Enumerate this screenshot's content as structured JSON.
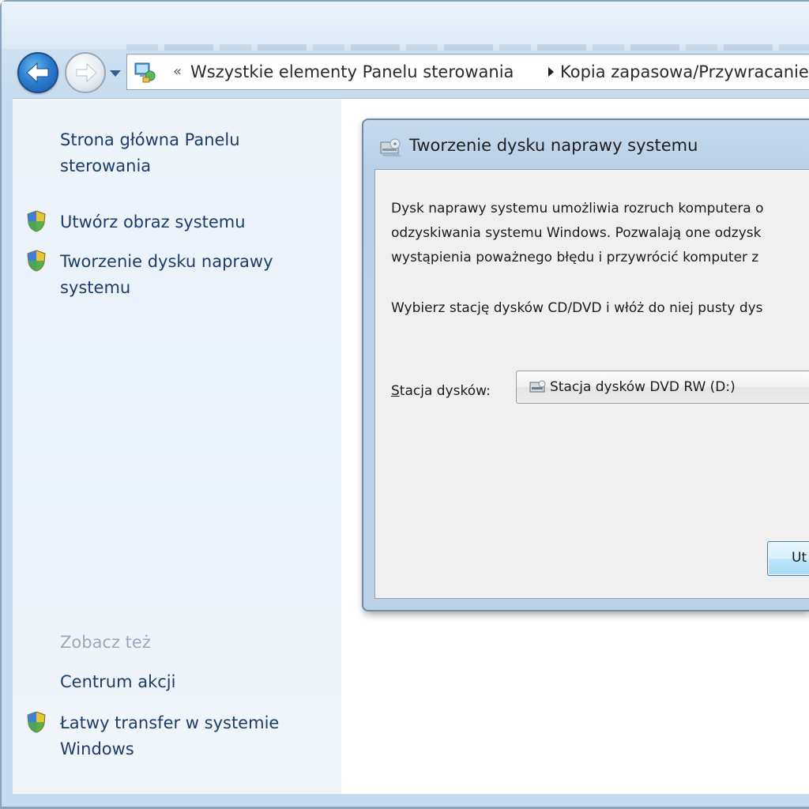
{
  "nav": {
    "breadcrumb": [
      {
        "label": "Wszystkie elementy Panelu sterowania"
      },
      {
        "label": "Kopia zapasowa/Przywracanie"
      }
    ],
    "first_chevron": "«"
  },
  "sidebar": {
    "home_link": "Strona główna Panelu sterowania",
    "tasks": [
      {
        "label": "Utwórz obraz systemu",
        "icon": "shield-icon"
      },
      {
        "label": "Tworzenie dysku naprawy systemu",
        "icon": "shield-icon"
      }
    ],
    "see_also_heading": "Zobacz też",
    "see_also": [
      {
        "label": "Centrum akcji"
      },
      {
        "label": "Łatwy transfer w systemie Windows",
        "icon": "shield-icon"
      }
    ]
  },
  "dialog": {
    "title": "Tworzenie dysku naprawy systemu",
    "description_lines": [
      "Dysk naprawy systemu umożliwia rozruch komputera o",
      "odzyskiwania systemu Windows. Pozwalają one odzysk",
      "wystąpienia poważnego błędu i przywrócić komputer z"
    ],
    "instruction": "Wybierz stację dysków CD/DVD i włóż do niej pusty dys",
    "drive_label_accel": "S",
    "drive_label_rest": "tacja dysków:",
    "drive_selected": "Stacja dysków DVD RW (D:)",
    "button_label": "Ut"
  },
  "colors": {
    "link": "#1b3d6b",
    "heading_muted": "#9aa9ba",
    "sidebar_bg": "#eef4fa",
    "dialog_frame": "#b9cfe6",
    "dialog_body": "#f0f0f0"
  }
}
